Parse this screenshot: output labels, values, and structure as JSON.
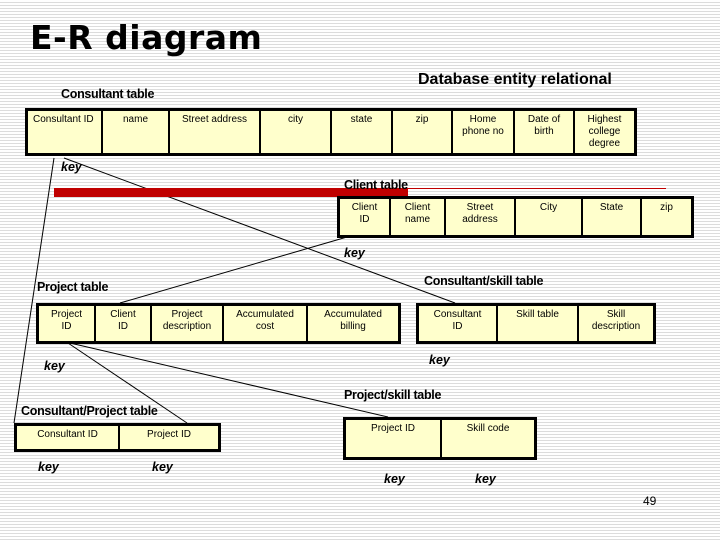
{
  "title": "E-R diagram",
  "subtitle": "Database entity relational",
  "page_number": "49",
  "accent_color": "#c00000",
  "cell_fill": "#ffffcc",
  "key_label": "key",
  "tables": {
    "consultant": {
      "label": "Consultant table",
      "columns": [
        "Consultant ID",
        "name",
        "Street address",
        "city",
        "state",
        "zip",
        "Home\nphone no",
        "Date of\nbirth",
        "Highest\ncollege\ndegree"
      ]
    },
    "client": {
      "label": "Client table",
      "columns": [
        "Client\nID",
        "Client\nname",
        "Street\naddress",
        "City",
        "State",
        "zip"
      ]
    },
    "project": {
      "label": "Project table",
      "columns": [
        "Project\nID",
        "Client\nID",
        "Project\ndescription",
        "Accumulated\ncost",
        "Accumulated\nbilling"
      ]
    },
    "consultant_skill": {
      "label": "Consultant/skill table",
      "columns": [
        "Consultant\nID",
        "Skill table",
        "Skill\ndescription"
      ]
    },
    "consultant_project": {
      "label": "Consultant/Project table",
      "columns": [
        "Consultant ID",
        "Project ID"
      ]
    },
    "project_skill": {
      "label": "Project/skill table",
      "columns": [
        "Project ID",
        "Skill code"
      ]
    }
  },
  "keys": {
    "consultant": "key",
    "client": "key",
    "project": "key",
    "consultant_skill": "key",
    "consultant_project_1": "key",
    "consultant_project_2": "key",
    "project_skill_1": "key",
    "project_skill_2": "key"
  }
}
